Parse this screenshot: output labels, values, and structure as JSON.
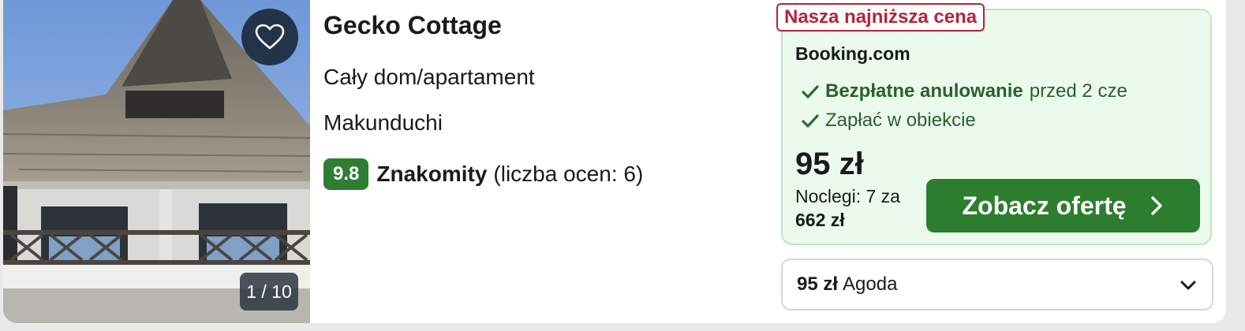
{
  "listing": {
    "name": "Gecko Cottage",
    "property_type": "Cały dom/apartament",
    "location": "Makunduchi",
    "rating": {
      "score": "9.8",
      "label": "Znakomity",
      "count_text": "(liczba ocen: 6)"
    },
    "photo": {
      "counter": "1 / 10"
    },
    "favorite_icon": "heart-outline-icon"
  },
  "deal": {
    "badge": "Nasza najniższa cena",
    "provider": "Booking.com",
    "features": [
      {
        "icon": "check-icon",
        "strong": "Bezpłatne anulowanie",
        "text": "przed 2 cze"
      },
      {
        "icon": "check-icon",
        "strong": "",
        "text": "Zapłać w obiekcie"
      }
    ],
    "price": "95 zł",
    "nights_text": "Noclegi: 7 za",
    "total": "662 zł",
    "cta_label": "Zobacz ofertę"
  },
  "other_offers": [
    {
      "price": "95 zł",
      "provider": "Agoda"
    }
  ],
  "colors": {
    "accent_green": "#2d7d2e",
    "badge_red": "#b3243b",
    "deal_bg": "#ecfaee",
    "score_bg": "#2e7d32"
  }
}
